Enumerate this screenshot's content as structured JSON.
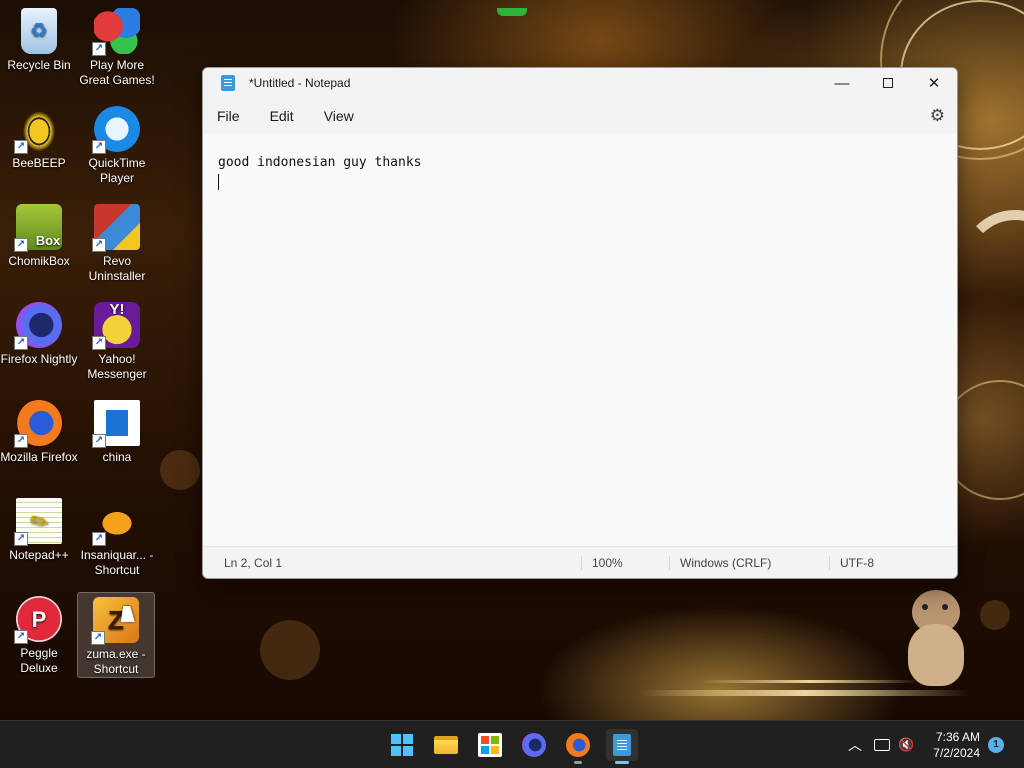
{
  "desktop": {
    "icons": [
      {
        "label": "Recycle Bin",
        "icon": "recycle-bin-icon"
      },
      {
        "label": "Play More Great Games!",
        "icon": "games-icon"
      },
      {
        "label": "BeeBEEP",
        "icon": "bee-icon"
      },
      {
        "label": "QuickTime Player",
        "icon": "quicktime-icon"
      },
      {
        "label": "ChomikBox",
        "icon": "chomikbox-icon",
        "icon_text": "Box"
      },
      {
        "label": "Revo Uninstaller",
        "icon": "revo-uninstaller-icon"
      },
      {
        "label": "Firefox Nightly",
        "icon": "firefox-nightly-icon"
      },
      {
        "label": "Yahoo! Messenger",
        "icon": "yahoo-messenger-icon",
        "icon_text": "Y!"
      },
      {
        "label": "Mozilla Firefox",
        "icon": "firefox-icon"
      },
      {
        "label": "china",
        "icon": "document-shortcut-icon"
      },
      {
        "label": "Notepad++",
        "icon": "notepadplusplus-icon"
      },
      {
        "label": "Insaniquar... - Shortcut",
        "icon": "fish-icon"
      },
      {
        "label": "Peggle Deluxe",
        "icon": "peggle-icon",
        "icon_text": "P"
      },
      {
        "label": "zuma.exe - Shortcut",
        "icon": "zuma-icon",
        "icon_text": "Z",
        "selected": true
      }
    ]
  },
  "notepad": {
    "title": "*Untitled - Notepad",
    "menu": {
      "file": "File",
      "edit": "Edit",
      "view": "View"
    },
    "content": "good indonesian guy thanks",
    "status": {
      "position": "Ln 2, Col 1",
      "zoom": "100%",
      "line_ending": "Windows (CRLF)",
      "encoding": "UTF-8"
    }
  },
  "taskbar": {
    "apps": [
      "start-icon",
      "file-explorer-icon",
      "microsoft-store-icon",
      "firefox-nightly-icon",
      "firefox-icon",
      "notepad-icon"
    ],
    "active_app": "notepad-icon",
    "time": "7:36 AM",
    "date": "7/2/2024",
    "notification_count": "1"
  },
  "colors": {
    "accent": "#60cdff",
    "taskbar": "#202020",
    "window_bg": "#f9f9f9"
  }
}
